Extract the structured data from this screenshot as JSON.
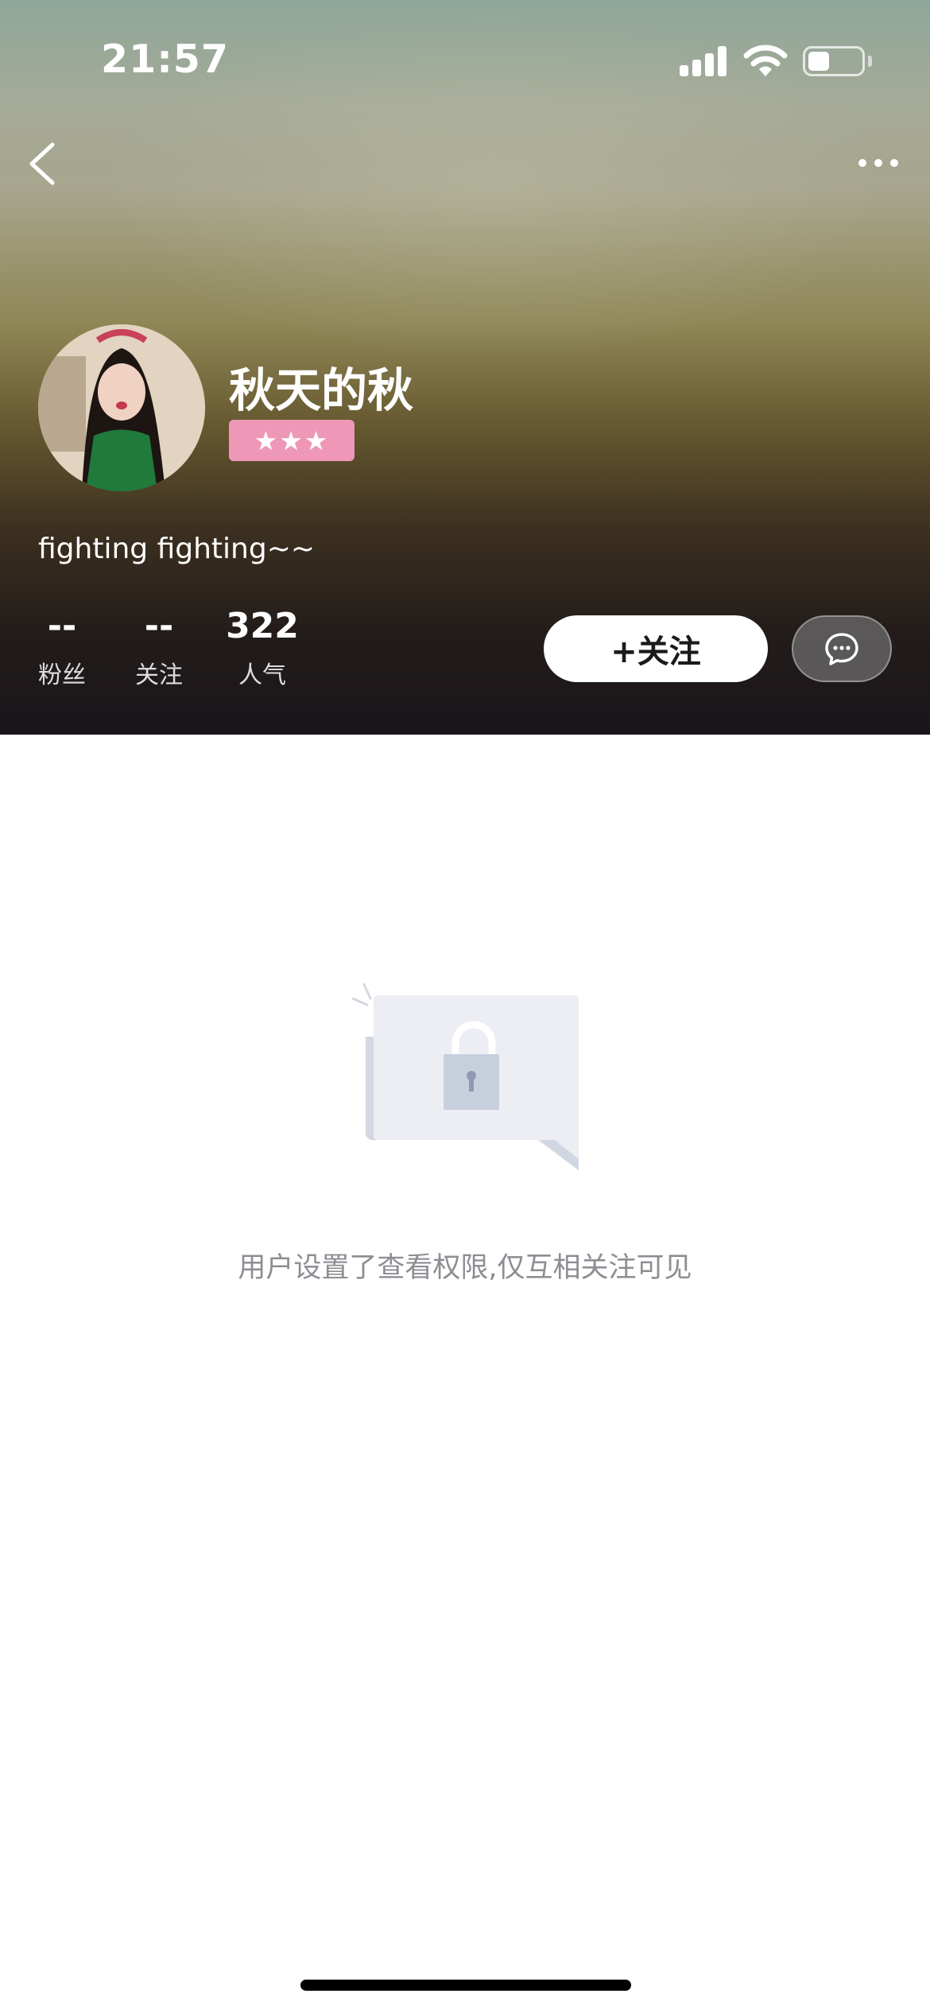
{
  "status_bar": {
    "time": "21:57",
    "signal_icon": "cellular-signal-icon",
    "wifi_icon": "wifi-icon",
    "battery_icon": "battery-icon",
    "battery_level": 0.4
  },
  "nav": {
    "back_icon": "chevron-left-icon",
    "more_icon": "more-dots-icon"
  },
  "profile": {
    "nickname": "秋天的秋",
    "level_stars": "★★★",
    "level_badge_color": "#ee97b7",
    "bio": "fighting fighting~~",
    "stats": {
      "fans_value": "--",
      "fans_label": "粉丝",
      "following_value": "--",
      "following_label": "关注",
      "popularity_value": "322",
      "popularity_label": "人气"
    },
    "follow_button_label": "+关注",
    "message_icon": "chat-bubble-icon"
  },
  "content": {
    "lock_icon": "lock-message-icon",
    "privacy_message": "用户设置了查看权限,仅互相关注可见"
  }
}
